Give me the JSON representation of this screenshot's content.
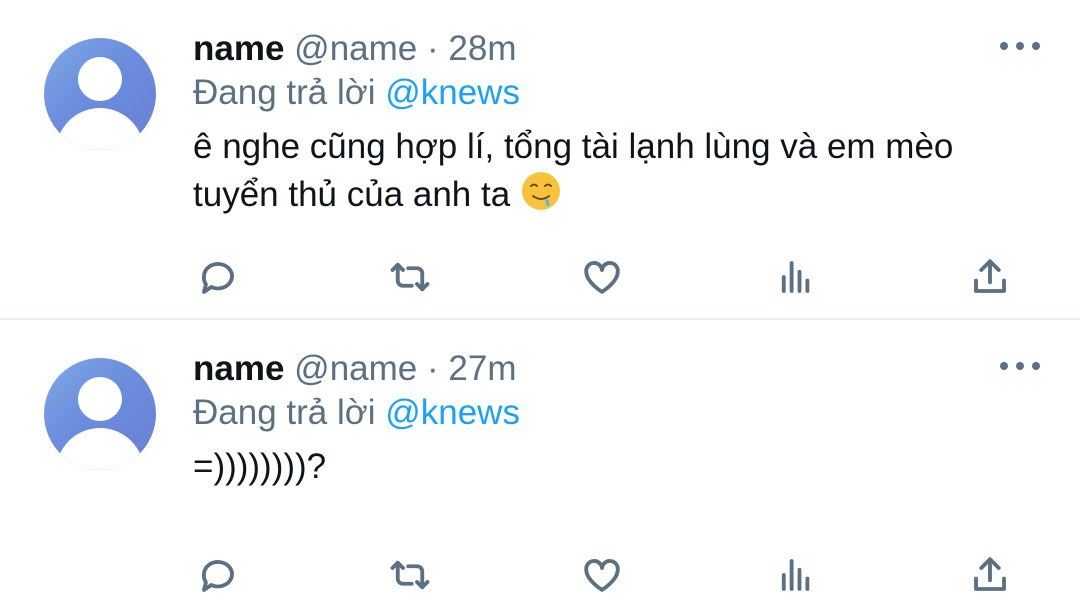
{
  "tweets": [
    {
      "display_name": "name",
      "handle": "@name",
      "separator": "·",
      "time": "28m",
      "reply_prefix": "Đang trả lời",
      "reply_mention": "@knews",
      "text_line1": "ê nghe cũng hợp lí, tổng tài lạnh lùng và em mèo",
      "text_line2": "tuyển thủ của anh ta",
      "emoji": "drooling-face-icon"
    },
    {
      "display_name": "name",
      "handle": "@name",
      "separator": "·",
      "time": "27m",
      "reply_prefix": "Đang trả lời",
      "reply_mention": "@knews",
      "text_line1": "=))))))))?"
    }
  ],
  "icons": {
    "reply": "reply-bubble-icon",
    "retweet": "retweet-icon",
    "like": "heart-icon",
    "stats": "analytics-icon",
    "share": "share-icon",
    "more": "more-dots-icon"
  },
  "colors": {
    "primary_text": "#0f1419",
    "secondary_text": "#5b7083",
    "mention": "#1da1f2",
    "divider": "#e7ecf0"
  }
}
